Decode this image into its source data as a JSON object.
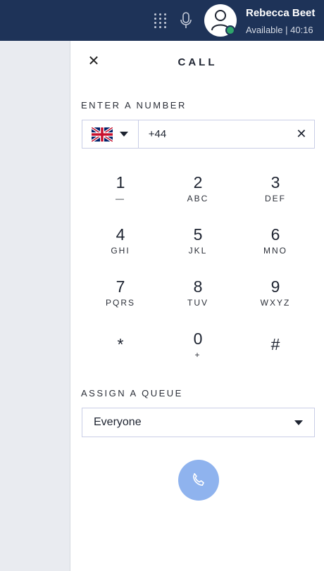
{
  "user": {
    "name": "Rebecca Beet",
    "status": "Available | 40:16"
  },
  "panel": {
    "title": "CALL",
    "number_label": "ENTER A NUMBER",
    "queue_label": "ASSIGN A QUEUE"
  },
  "number_input": {
    "value": "+44",
    "country": "United Kingdom"
  },
  "keypad": [
    {
      "digit": "1",
      "letters": "—"
    },
    {
      "digit": "2",
      "letters": "ABC"
    },
    {
      "digit": "3",
      "letters": "DEF"
    },
    {
      "digit": "4",
      "letters": "GHI"
    },
    {
      "digit": "5",
      "letters": "JKL"
    },
    {
      "digit": "6",
      "letters": "MNO"
    },
    {
      "digit": "7",
      "letters": "PQRS"
    },
    {
      "digit": "8",
      "letters": "TUV"
    },
    {
      "digit": "9",
      "letters": "WXYZ"
    },
    {
      "digit": "*",
      "letters": ""
    },
    {
      "digit": "0",
      "letters": "+"
    },
    {
      "digit": "#",
      "letters": ""
    }
  ],
  "queue": {
    "selected": "Everyone"
  },
  "icons": {
    "close": "close-icon",
    "clear": "clear-icon",
    "call": "phone-icon",
    "mic": "microphone-icon",
    "dialpad": "dialpad-icon"
  },
  "colors": {
    "topbar": "#1e3358",
    "presence": "#2fa56b",
    "call_button": "#8fb3ee"
  }
}
